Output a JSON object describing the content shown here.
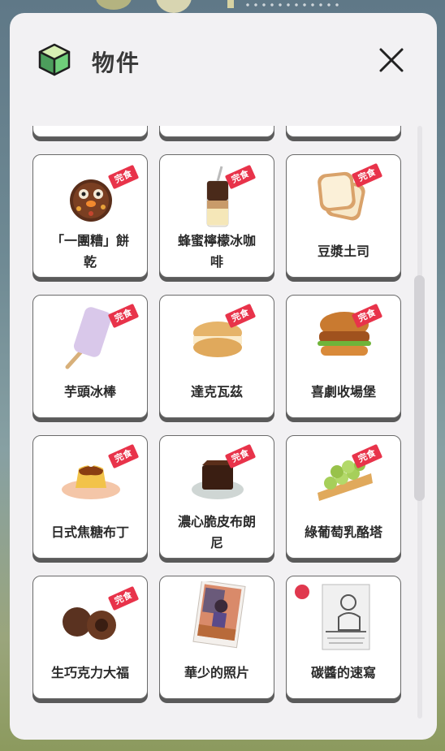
{
  "header": {
    "title": "物件",
    "icon": "cube-icon",
    "close_icon": "close-icon"
  },
  "colors": {
    "badge": "#e8334a",
    "cube_top": "#d7efb3",
    "cube_left": "#4c9e5c",
    "cube_right": "#6fcf7a"
  },
  "items": [
    {
      "label": "「一團糟」餅乾",
      "label_lines": [
        "「一團糟」餅",
        "乾"
      ],
      "badge": "完食",
      "icon": "cookie-icon"
    },
    {
      "label": "蜂蜜檸檬冰咖啡",
      "label_lines": [
        "蜂蜜檸檬冰咖",
        "啡"
      ],
      "badge": "完食",
      "icon": "iced-coffee-icon"
    },
    {
      "label": "豆漿土司",
      "label_lines": [
        "豆漿土司"
      ],
      "badge": "完食",
      "icon": "toast-icon"
    },
    {
      "label": "芋頭冰棒",
      "label_lines": [
        "芋頭冰棒"
      ],
      "badge": "完食",
      "icon": "popsicle-icon"
    },
    {
      "label": "達克瓦茲",
      "label_lines": [
        "達克瓦茲"
      ],
      "badge": "完食",
      "icon": "dacquoise-icon"
    },
    {
      "label": "喜劇收場堡",
      "label_lines": [
        "喜劇收場堡"
      ],
      "badge": "完食",
      "icon": "burger-icon"
    },
    {
      "label": "日式焦糖布丁",
      "label_lines": [
        "日式焦糖布丁"
      ],
      "badge": "完食",
      "icon": "pudding-icon"
    },
    {
      "label": "濃心脆皮布朗尼",
      "label_lines": [
        "濃心脆皮布朗",
        "尼"
      ],
      "badge": "完食",
      "icon": "brownie-icon"
    },
    {
      "label": "綠葡萄乳酪塔",
      "label_lines": [
        "綠葡萄乳酪塔"
      ],
      "badge": "完食",
      "icon": "grape-tart-icon"
    },
    {
      "label": "生巧克力大福",
      "label_lines": [
        "生巧克力大福"
      ],
      "badge": "完食",
      "icon": "chocolate-daifuku-icon"
    },
    {
      "label": "華少的照片",
      "label_lines": [
        "華少的照片"
      ],
      "badge": "",
      "icon": "photo-icon"
    },
    {
      "label": "碳醬的速寫",
      "label_lines": [
        "碳醬的速寫"
      ],
      "badge": "",
      "icon": "sketch-icon",
      "new": true
    }
  ]
}
